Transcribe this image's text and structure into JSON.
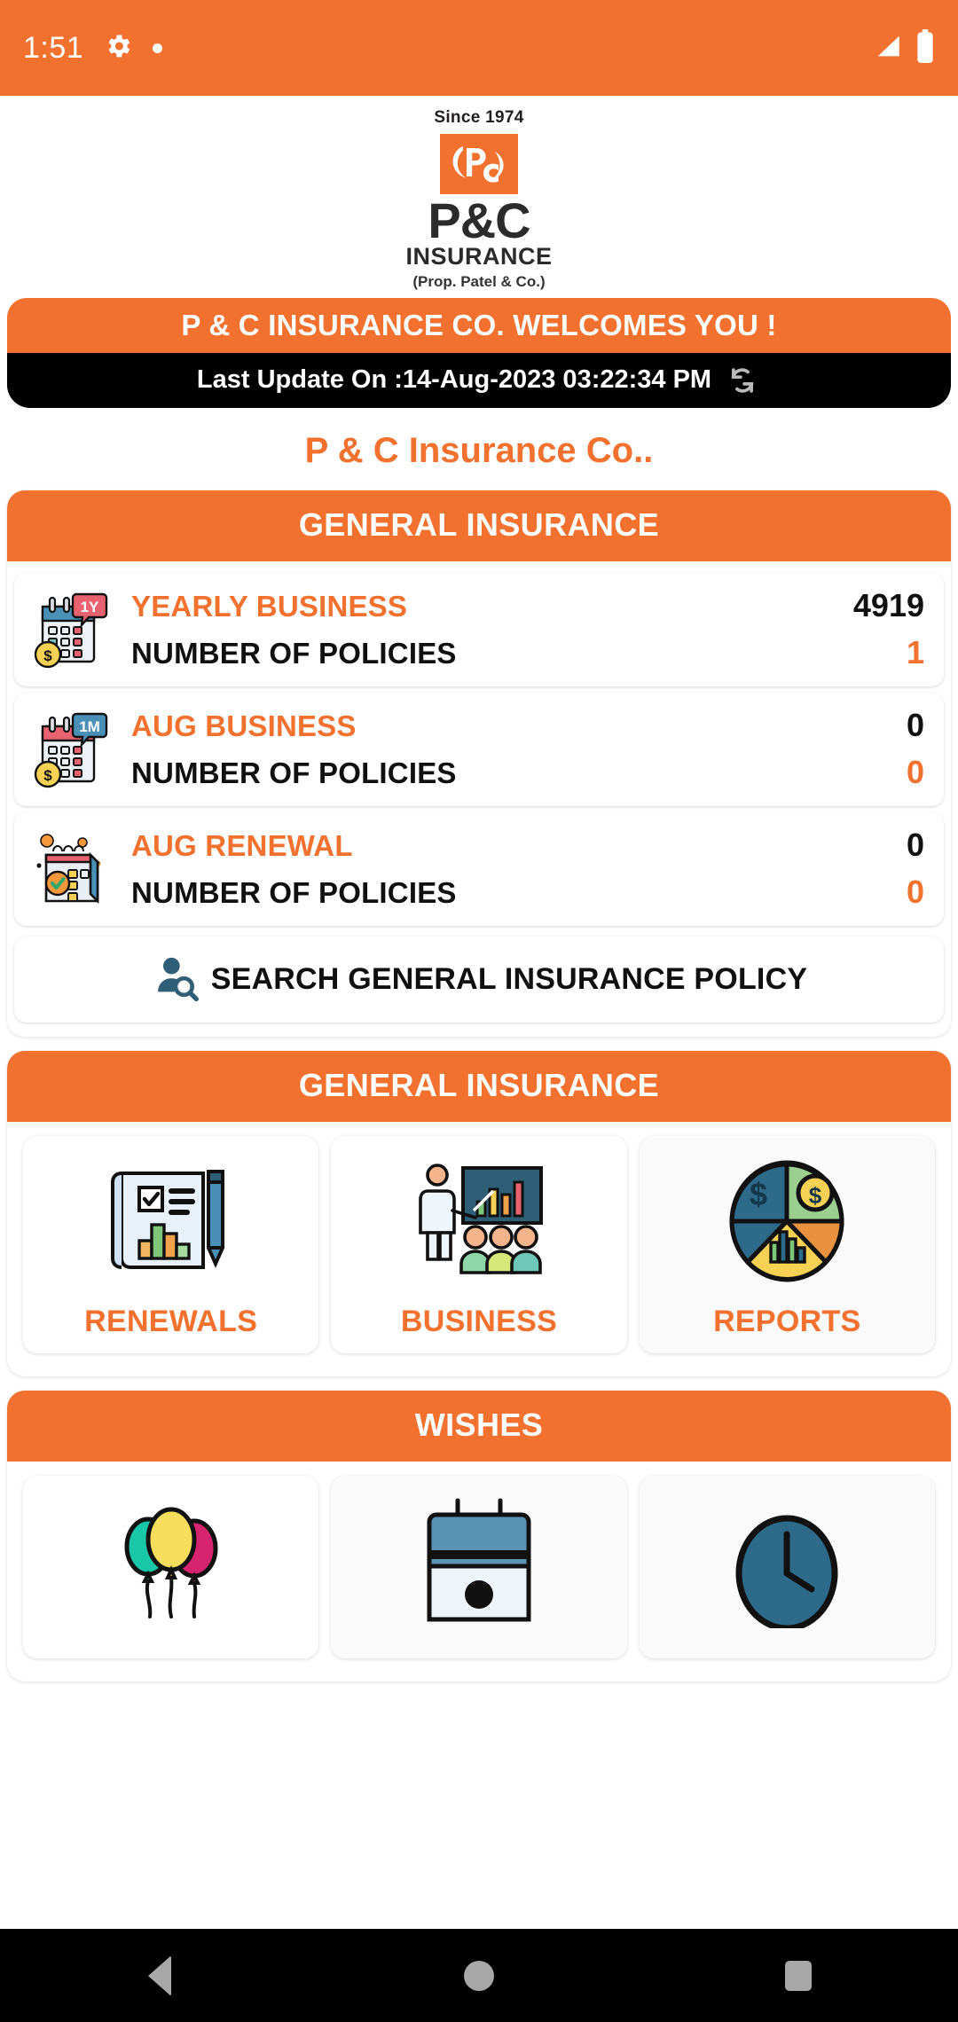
{
  "status_bar": {
    "time": "1:51",
    "icons": [
      "gear-icon",
      "dot-icon",
      "signal-icon",
      "battery-icon"
    ]
  },
  "logo": {
    "since": "Since 1974",
    "brand_primary": "P&C",
    "brand_secondary": "INSURANCE",
    "proprietor": "(Prop. Patel & Co.)"
  },
  "banner": {
    "welcome": "P & C INSURANCE CO. WELCOMES YOU !",
    "last_update": "Last Update On :14-Aug-2023 03:22:34 PM",
    "refresh_icon": "refresh-icon"
  },
  "company_title": "P & C Insurance Co..",
  "general_insurance_stats": {
    "header": "GENERAL INSURANCE",
    "rows": [
      {
        "icon": "calendar-1y-dollar-icon",
        "label": "YEARLY BUSINESS",
        "value": "4919",
        "sublabel": "NUMBER OF POLICIES",
        "subvalue": "1"
      },
      {
        "icon": "calendar-1m-dollar-icon",
        "label": "AUG BUSINESS",
        "value": "0",
        "sublabel": "NUMBER OF POLICIES",
        "subvalue": "0"
      },
      {
        "icon": "calendar-check-icon",
        "label": "AUG RENEWAL",
        "value": "0",
        "sublabel": "NUMBER OF POLICIES",
        "subvalue": "0"
      }
    ],
    "search_label": "SEARCH GENERAL INSURANCE POLICY",
    "search_icon": "person-search-icon"
  },
  "general_insurance_menu": {
    "header": "GENERAL INSURANCE",
    "tiles": [
      {
        "label": "RENEWALS",
        "icon": "clipboard-pencil-chart-icon"
      },
      {
        "label": "BUSINESS",
        "icon": "presentation-audience-icon"
      },
      {
        "label": "REPORTS",
        "icon": "pie-chart-dollar-icon"
      }
    ]
  },
  "wishes": {
    "header": "WISHES",
    "tiles": [
      {
        "label": "",
        "icon": "balloons-icon"
      },
      {
        "label": "",
        "icon": "calendar-icon"
      },
      {
        "label": "",
        "icon": "clock-icon"
      }
    ]
  },
  "nav_bar": {
    "back": "back-button",
    "home": "home-button",
    "recents": "recents-button"
  },
  "colors": {
    "accent": "#F2712E",
    "dark": "#000000",
    "text": "#101010"
  }
}
